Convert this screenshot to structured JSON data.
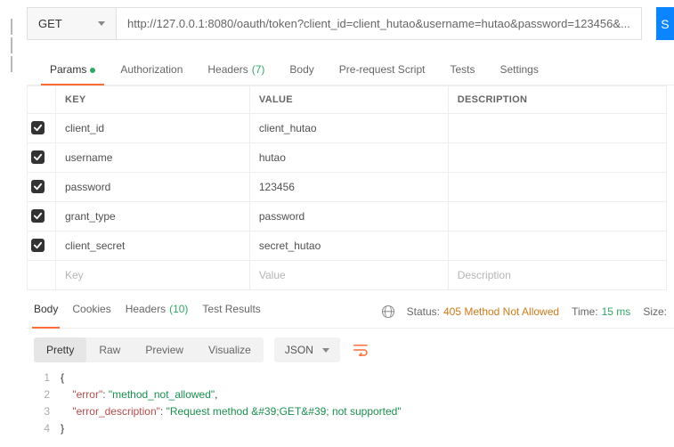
{
  "request": {
    "method": "GET",
    "url": "http://127.0.0.1:8080/oauth/token?client_id=client_hutao&username=hutao&password=123456&...",
    "send_label": "S"
  },
  "tabs": {
    "params": "Params",
    "auth": "Authorization",
    "headers": "Headers",
    "headers_count": "(7)",
    "body": "Body",
    "prereq": "Pre-request Script",
    "tests": "Tests",
    "settings": "Settings"
  },
  "table": {
    "key_header": "KEY",
    "value_header": "VALUE",
    "desc_header": "DESCRIPTION",
    "rows": [
      {
        "key": "client_id",
        "value": "client_hutao"
      },
      {
        "key": "username",
        "value": "hutao"
      },
      {
        "key": "password",
        "value": "123456"
      },
      {
        "key": "grant_type",
        "value": "password"
      },
      {
        "key": "client_secret",
        "value": "secret_hutao"
      }
    ],
    "ph_key": "Key",
    "ph_value": "Value",
    "ph_desc": "Description"
  },
  "response": {
    "tabs": {
      "body": "Body",
      "cookies": "Cookies",
      "headers": "Headers",
      "headers_count": "(10)",
      "test_results": "Test Results"
    },
    "status_label": "Status:",
    "status_value": "405 Method Not Allowed",
    "time_label": "Time:",
    "time_value": "15 ms",
    "size_label": "Size:"
  },
  "viewer": {
    "pretty": "Pretty",
    "raw": "Raw",
    "preview": "Preview",
    "visualize": "Visualize",
    "format": "JSON"
  },
  "body_json": {
    "l1": "{",
    "l2a": "    \"",
    "l2key": "error",
    "l2b": "\"",
    "l2c": ": ",
    "l2d": "\"method_not_allowed\"",
    "l2e": ",",
    "l3a": "    \"",
    "l3key": "error_description",
    "l3b": "\"",
    "l3c": ": ",
    "l3d": "\"Request method &#39;GET&#39; not supported\"",
    "l4": "}"
  }
}
